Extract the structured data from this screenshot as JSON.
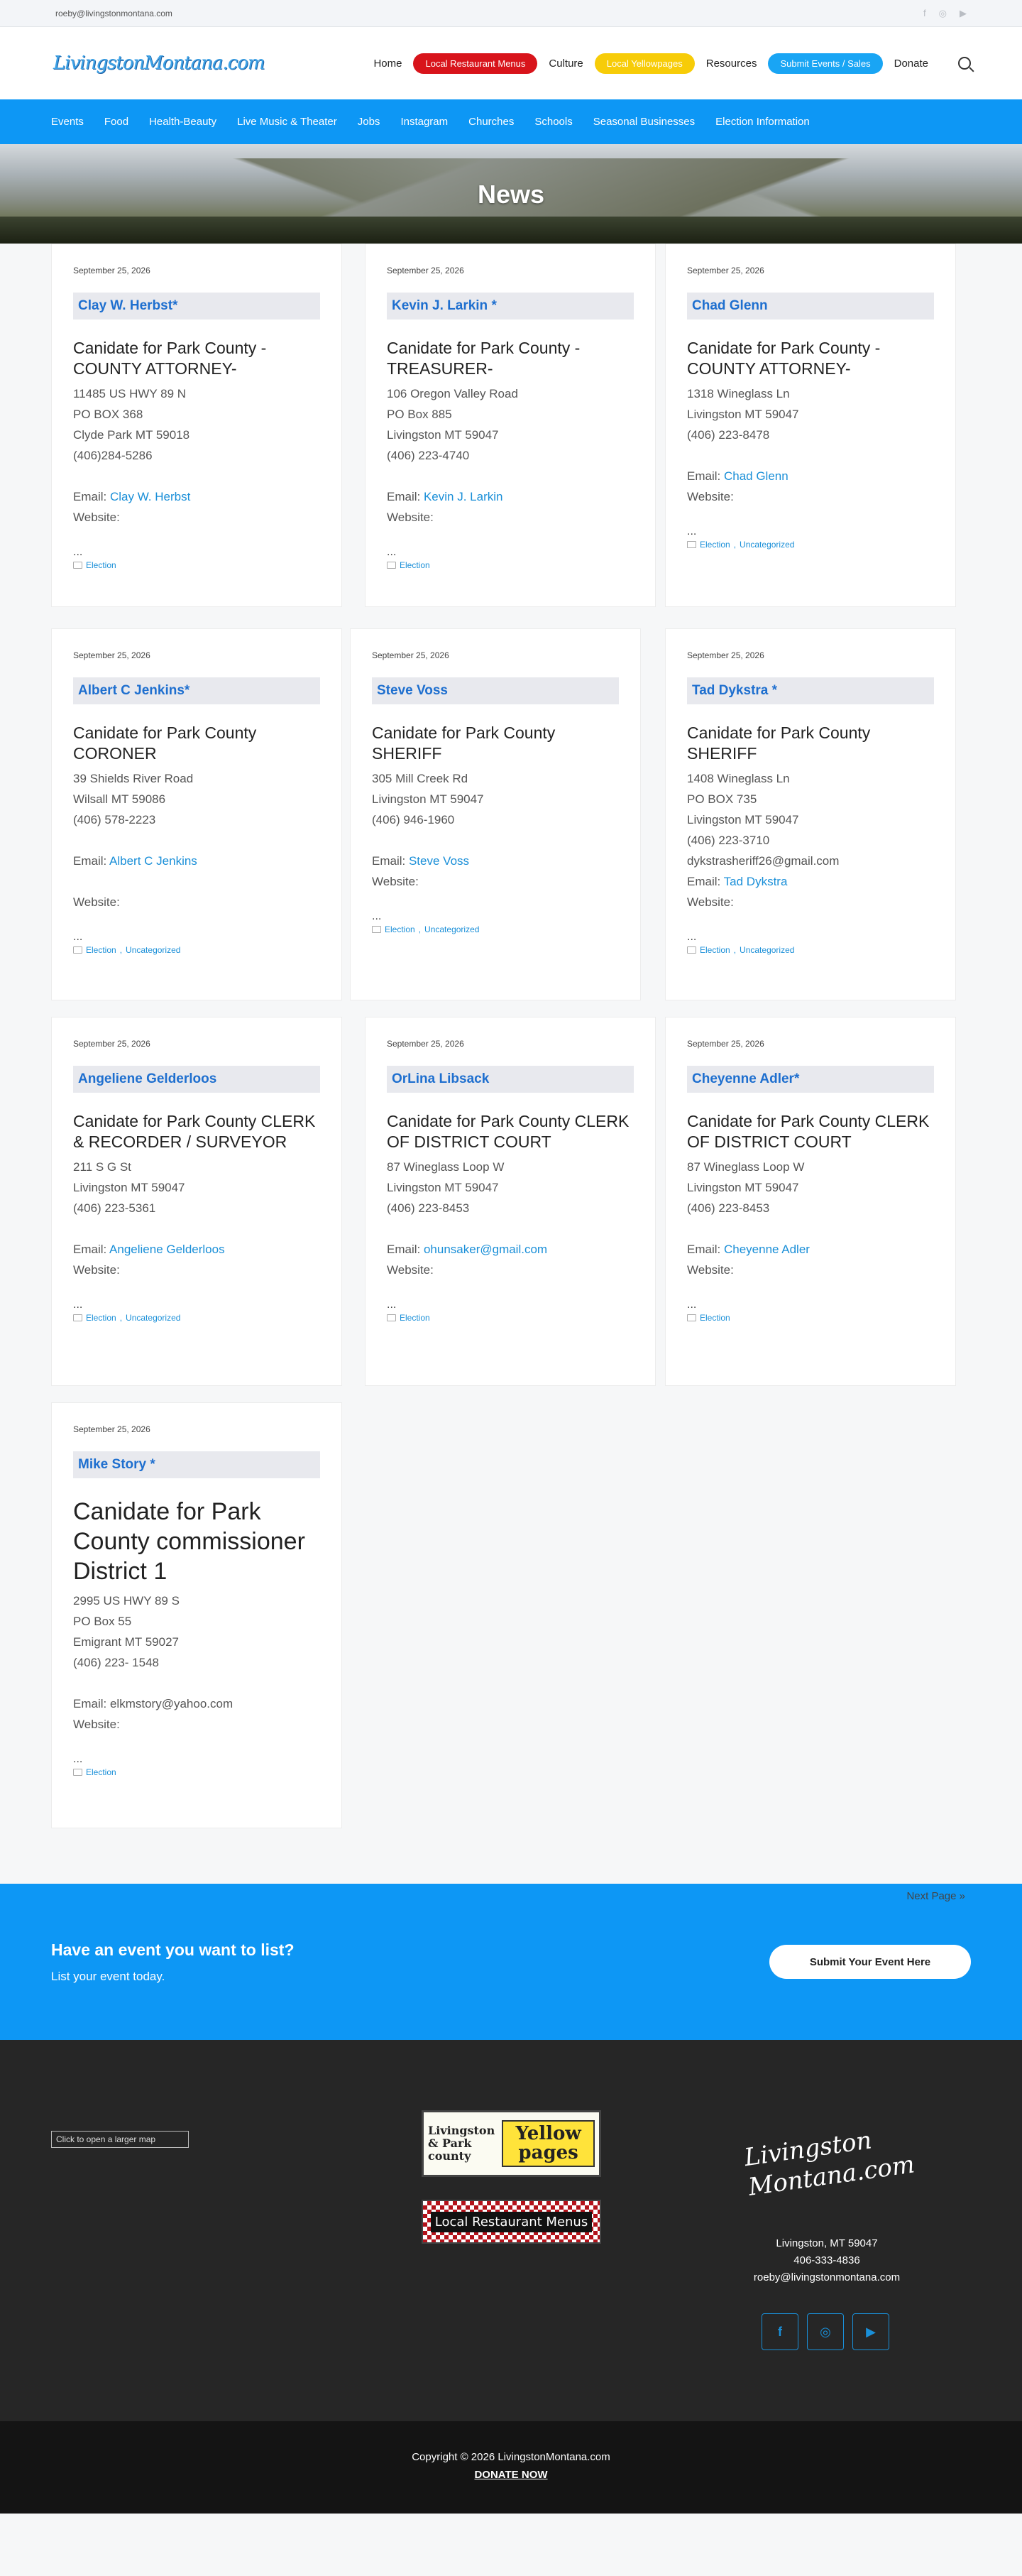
{
  "topbar": {
    "email": "roeby@livingstonmontana.com",
    "socials": [
      "f",
      "◎",
      "▶"
    ]
  },
  "header": {
    "logo": "LivingstonMontana.com",
    "nav": [
      {
        "label": "Home",
        "style": "plain"
      },
      {
        "label": "Local Restaurant Menus",
        "style": "red"
      },
      {
        "label": "Culture",
        "style": "plain"
      },
      {
        "label": "Local Yellowpages",
        "style": "yellow"
      },
      {
        "label": "Resources",
        "style": "plain"
      },
      {
        "label": "Submit Events / Sales",
        "style": "blue"
      },
      {
        "label": "Donate",
        "style": "plain"
      }
    ]
  },
  "catnav": [
    "Events",
    "Food",
    "Health-Beauty",
    "Live Music & Theater",
    "Jobs",
    "Instagram",
    "Churches",
    "Schools",
    "Seasonal Businesses",
    "Election Information"
  ],
  "hero": {
    "title": "News"
  },
  "posts": [
    {
      "date": "September 25, 2026",
      "name": "Clay W. Herbst*",
      "title": "Canidate for Park County -COUNTY ATTORNEY-",
      "lines": [
        "11485 US HWY 89 N",
        "PO BOX 368",
        "Clyde Park MT 59018",
        "(406)284-5286"
      ],
      "email_label": "Email: ",
      "email": "Clay W. Herbst",
      "email_link": true,
      "website": "Website:",
      "ellipsis": "...",
      "cats": [
        "Election"
      ]
    },
    {
      "date": "September 25, 2026",
      "name": "Kevin J. Larkin *",
      "title": "Canidate for Park County -TREASURER-",
      "lines": [
        "106 Oregon Valley Road",
        "PO Box 885",
        "Livingston MT 59047",
        "(406) 223-4740"
      ],
      "email_label": "Email: ",
      "email": "Kevin J. Larkin",
      "email_link": true,
      "website": "Website:",
      "ellipsis": "...",
      "cats": [
        "Election"
      ]
    },
    {
      "date": "September 25, 2026",
      "name": "Chad Glenn",
      "title": "Canidate for Park County -COUNTY ATTORNEY-",
      "lines": [
        "1318 Wineglass Ln",
        "Livingston MT 59047",
        "(406) 223-8478"
      ],
      "email_label": "Email: ",
      "email": "Chad Glenn",
      "email_link": true,
      "website": "Website:",
      "ellipsis": "...",
      "cats": [
        "Election",
        "Uncategorized"
      ]
    },
    {
      "date": "September 25, 2026",
      "name": "Albert C Jenkins*",
      "title": "Canidate for Park County CORONER",
      "lines": [
        "39 Shields River Road",
        "Wilsall MT 59086",
        "(406) 578-2223"
      ],
      "email_label": "Email: ",
      "email": "Albert C Jenkins",
      "email_link": true,
      "website": "Website:",
      "ellipsis": "...",
      "cats": [
        "Election",
        "Uncategorized"
      ]
    },
    {
      "date": "September 25, 2026",
      "name": "Steve Voss",
      "title": "Canidate for Park County SHERIFF",
      "lines": [
        "305 Mill Creek Rd",
        "Livingston MT 59047",
        "(406) 946-1960"
      ],
      "email_label": "Email: ",
      "email": "Steve Voss",
      "email_link": true,
      "website": "Website:",
      "ellipsis": "...",
      "cats": [
        "Election",
        "Uncategorized"
      ]
    },
    {
      "date": "September 25, 2026",
      "name": "Tad Dykstra *",
      "title": "Canidate for Park County SHERIFF",
      "lines": [
        "1408 Wineglass Ln",
        "PO BOX 735",
        "Livingston MT 59047",
        "(406) 223-3710",
        "dykstrasheriff26@gmail.com"
      ],
      "email_label": "Email: ",
      "email": "Tad Dykstra",
      "email_link": true,
      "website": "Website:",
      "ellipsis": "...",
      "cats": [
        "Election",
        "Uncategorized"
      ]
    },
    {
      "date": "September 25, 2026",
      "name": "Angeliene Gelderloos",
      "title": "Canidate for Park County CLERK & RECORDER / SURVEYOR",
      "lines": [
        "211 S G St",
        "Livingston MT 59047",
        "(406) 223-5361"
      ],
      "email_label": "Email: ",
      "email": "Angeliene Gelderloos",
      "email_link": true,
      "website": "Website:",
      "ellipsis": "...",
      "cats": [
        "Election",
        "Uncategorized"
      ]
    },
    {
      "date": "September 25, 2026",
      "name": "OrLina Libsack",
      "title": "Canidate for Park County CLERK OF DISTRICT COURT",
      "lines": [
        "87 Wineglass Loop W",
        "Livingston MT 59047",
        "(406) 223-8453"
      ],
      "email_label": "Email: ",
      "email": "ohunsaker@gmail.com",
      "email_link": true,
      "website": "Website:",
      "ellipsis": "...",
      "cats": [
        "Election"
      ]
    },
    {
      "date": "September 25, 2026",
      "name": "Cheyenne Adler*",
      "title": "Canidate for Park County CLERK OF DISTRICT COURT",
      "lines": [
        "87 Wineglass Loop W",
        "Livingston MT 59047",
        "(406) 223-8453"
      ],
      "email_label": "Email: ",
      "email": "Cheyenne Adler",
      "email_link": true,
      "website": "Website:",
      "ellipsis": "...",
      "cats": [
        "Election"
      ]
    },
    {
      "date": "September 25, 2026",
      "name": "Mike Story *",
      "title": "Canidate for Park County commissioner District 1",
      "lines": [
        "2995 US HWY 89 S",
        "PO Box 55",
        "Emigrant MT 59027",
        "(406) 223- 1548"
      ],
      "email_label": "Email: ",
      "email": "elkmstory@yahoo.com",
      "email_link": false,
      "website": "Website:",
      "ellipsis": "...",
      "cats": [
        "Election"
      ]
    }
  ],
  "pagination": {
    "next": "Next Page »"
  },
  "cta": {
    "heading": "Have an event you want to list?",
    "sub": "List your event today.",
    "button": "Submit Your Event Here"
  },
  "footer": {
    "map_alt": "Click to open a larger map",
    "yp_left": "Livingston & Park county",
    "yp_right": "Yellow pages",
    "lrm": "Local Restaurant Menus",
    "logo": "Livingston Montana.com",
    "addr": [
      "Livingston, MT 59047",
      "406-333-4836",
      "roeby@livingstonmontana.com"
    ],
    "socials": [
      "f",
      "◎",
      "▶"
    ]
  },
  "bottom": {
    "copyright": "Copyright © 2026 LivingstonMontana.com",
    "donate": "DONATE NOW"
  }
}
